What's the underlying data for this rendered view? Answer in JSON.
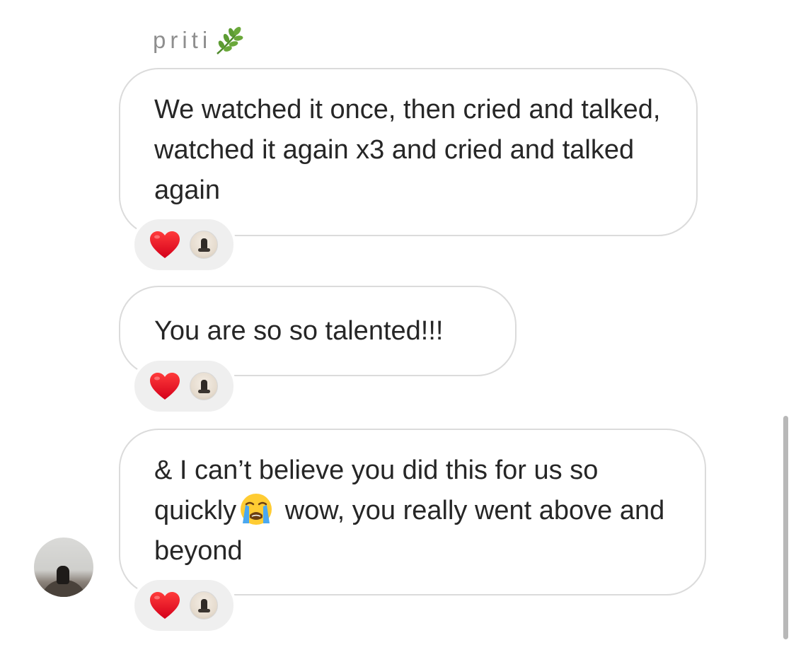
{
  "sender": {
    "name": "priti",
    "name_icon": "herb-leaf-icon"
  },
  "messages": [
    {
      "text": "We watched it once, then cried and talked, watched it again x3 and cried and talked again",
      "reaction": "heart-icon"
    },
    {
      "text": "You are so so talented!!!",
      "reaction": "heart-icon"
    },
    {
      "text_before_emoji": "& I can’t believe you did this for us so quickly",
      "emoji": "loudly-crying-face-icon",
      "text_after_emoji": " wow, you really went above and beyond",
      "reaction": "heart-icon"
    }
  ],
  "colors": {
    "bubble_border": "#dbdbdb",
    "reaction_bg": "#efefef",
    "heart": "#e8192c",
    "text": "#262626",
    "name": "#8e8e8e"
  }
}
